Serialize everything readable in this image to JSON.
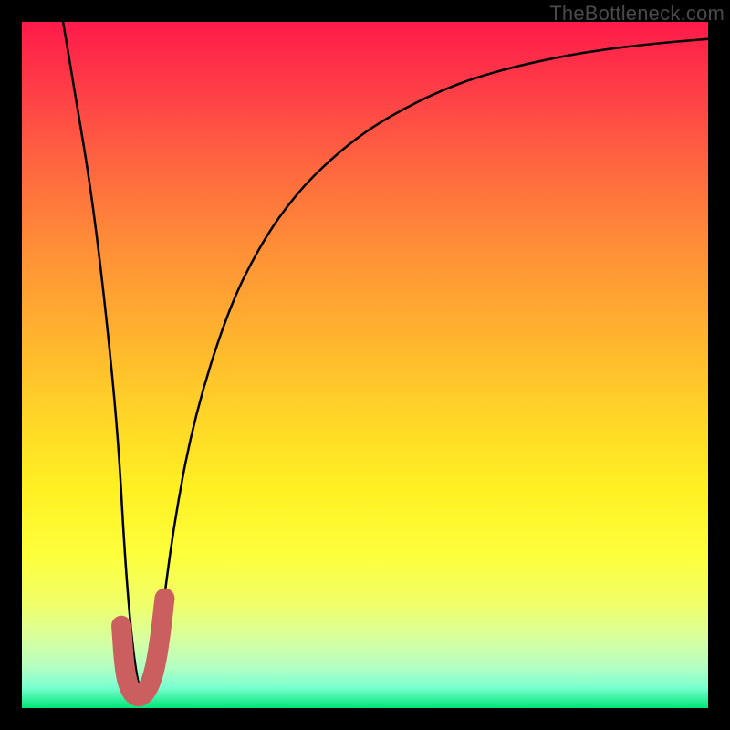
{
  "watermark": "TheBottleneck.com",
  "colors": {
    "background": "#000000",
    "curve_line": "#000000",
    "j_marker": "#cb5f5f"
  },
  "chart_data": {
    "type": "line",
    "title": "",
    "xlabel": "",
    "ylabel": "",
    "xlim": [
      0,
      100
    ],
    "ylim": [
      0,
      100
    ],
    "grid": false,
    "series": [
      {
        "name": "bottleneck-curve",
        "x": [
          6,
          8,
          10,
          12,
          14,
          15,
          16,
          17,
          18,
          19,
          20,
          22,
          25,
          30,
          35,
          40,
          45,
          50,
          55,
          60,
          65,
          70,
          75,
          80,
          85,
          90,
          95,
          100
        ],
        "y": [
          100,
          88,
          76,
          60,
          40,
          22,
          10,
          3,
          1,
          3,
          10,
          26,
          42,
          58,
          68,
          75,
          80,
          84,
          87,
          89.5,
          91.5,
          93,
          94.2,
          95.2,
          96,
          96.6,
          97.1,
          97.5
        ]
      }
    ],
    "annotations": [
      {
        "name": "j-marker",
        "type": "path",
        "color": "#cb5f5f",
        "points": [
          {
            "x": 14.5,
            "y": 12
          },
          {
            "x": 15.0,
            "y": 5
          },
          {
            "x": 16.0,
            "y": 2
          },
          {
            "x": 17.5,
            "y": 1.5
          },
          {
            "x": 19.0,
            "y": 4
          },
          {
            "x": 20.0,
            "y": 9
          },
          {
            "x": 20.8,
            "y": 16
          }
        ]
      }
    ]
  }
}
